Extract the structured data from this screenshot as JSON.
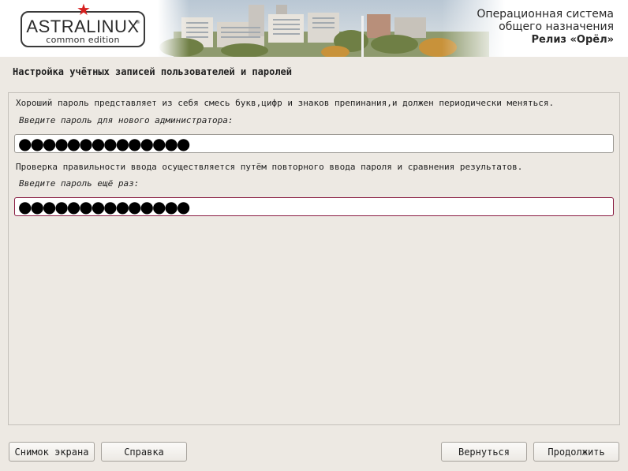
{
  "header": {
    "logo": {
      "name": "ASTRALINUX",
      "registered": "®",
      "edition": "common edition"
    },
    "os_title_line1": "Операционная система",
    "os_title_line2": "общего назначения",
    "os_release": "Релиз «Орёл»"
  },
  "page": {
    "title": "Настройка учётных записей пользователей и паролей"
  },
  "form": {
    "intro_text": "Хороший пароль представляет из себя смесь букв,цифр и знаков препинания,и должен периодически меняться.",
    "password_label": "Введите пароль для нового администратора:",
    "password_value": "●●●●●●●●●●●●●●",
    "verify_text": "Проверка правильности ввода осуществляется путём повторного ввода пароля и сравнения результатов.",
    "confirm_label": "Введите пароль ещё раз:",
    "confirm_value": "●●●●●●●●●●●●●●"
  },
  "buttons": {
    "screenshot": "Снимок экрана",
    "help": "Справка",
    "back": "Вернуться",
    "continue": "Продолжить"
  },
  "colors": {
    "background": "#ede9e3",
    "focus_border": "#8a1d43",
    "logo_star": "#d6201f"
  }
}
